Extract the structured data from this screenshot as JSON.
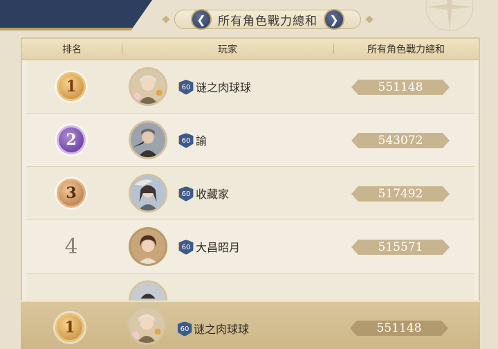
{
  "title": "所有角色戰力總和",
  "nav": {
    "prev_icon": "chevron-left-icon",
    "next_icon": "chevron-right-icon"
  },
  "columns": {
    "rank": "排名",
    "player": "玩家",
    "power": "所有角色戰力總和"
  },
  "rows": [
    {
      "rank": "1",
      "medal": "gold",
      "level": "60",
      "name": "谜之肉球球",
      "power": "551148"
    },
    {
      "rank": "2",
      "medal": "purple",
      "level": "60",
      "name": "諭",
      "power": "543072"
    },
    {
      "rank": "3",
      "medal": "bronze",
      "level": "60",
      "name": "收藏家",
      "power": "517492"
    },
    {
      "rank": "4",
      "medal": "",
      "level": "60",
      "name": "大昌昭月",
      "power": "515571"
    }
  ],
  "self": {
    "rank": "1",
    "medal": "gold",
    "level": "60",
    "name": "谜之肉球球",
    "power": "551148"
  },
  "colors": {
    "navy": "#2e3e5e",
    "gold": "#c6833a",
    "purple": "#5b2f8e",
    "bronze": "#b1703e"
  }
}
